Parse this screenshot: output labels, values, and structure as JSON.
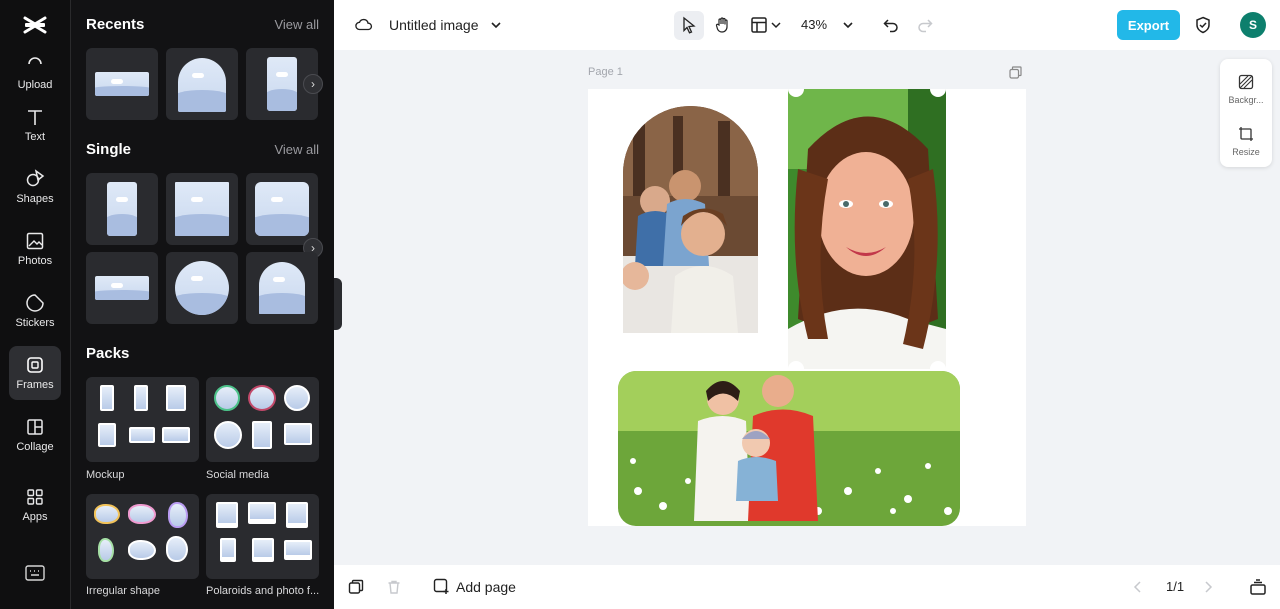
{
  "app": {
    "logo": "capcut-logo-icon"
  },
  "rail": {
    "items": [
      {
        "label": "Upload",
        "icon": "upload-icon"
      },
      {
        "label": "Text",
        "icon": "text-icon"
      },
      {
        "label": "Shapes",
        "icon": "shapes-icon"
      },
      {
        "label": "Photos",
        "icon": "photos-icon"
      },
      {
        "label": "Stickers",
        "icon": "stickers-icon"
      },
      {
        "label": "Frames",
        "icon": "frames-icon",
        "active": true
      },
      {
        "label": "Collage",
        "icon": "collage-icon"
      },
      {
        "label": "Apps",
        "icon": "apps-icon"
      }
    ],
    "bottom_icon": "keyboard-icon"
  },
  "panel": {
    "recents": {
      "title": "Recents",
      "view_all": "View all"
    },
    "single": {
      "title": "Single",
      "view_all": "View all"
    },
    "packs": {
      "title": "Packs",
      "items": [
        {
          "label": "Mockup"
        },
        {
          "label": "Social media"
        },
        {
          "label": "Irregular shape"
        },
        {
          "label": "Polaroids and photo f..."
        }
      ]
    }
  },
  "topbar": {
    "title": "Untitled image",
    "zoom": "43%",
    "export_label": "Export",
    "avatar_initial": "S"
  },
  "canvas": {
    "page_label": "Page 1"
  },
  "float_panel": {
    "background_label": "Backgr...",
    "resize_label": "Resize"
  },
  "bottombar": {
    "add_page_label": "Add page",
    "pager": "1/1"
  },
  "colors": {
    "accent": "#22b8e8",
    "avatar": "#0d7f6d",
    "rail_bg": "#0f0f10",
    "panel_bg": "#121214"
  }
}
